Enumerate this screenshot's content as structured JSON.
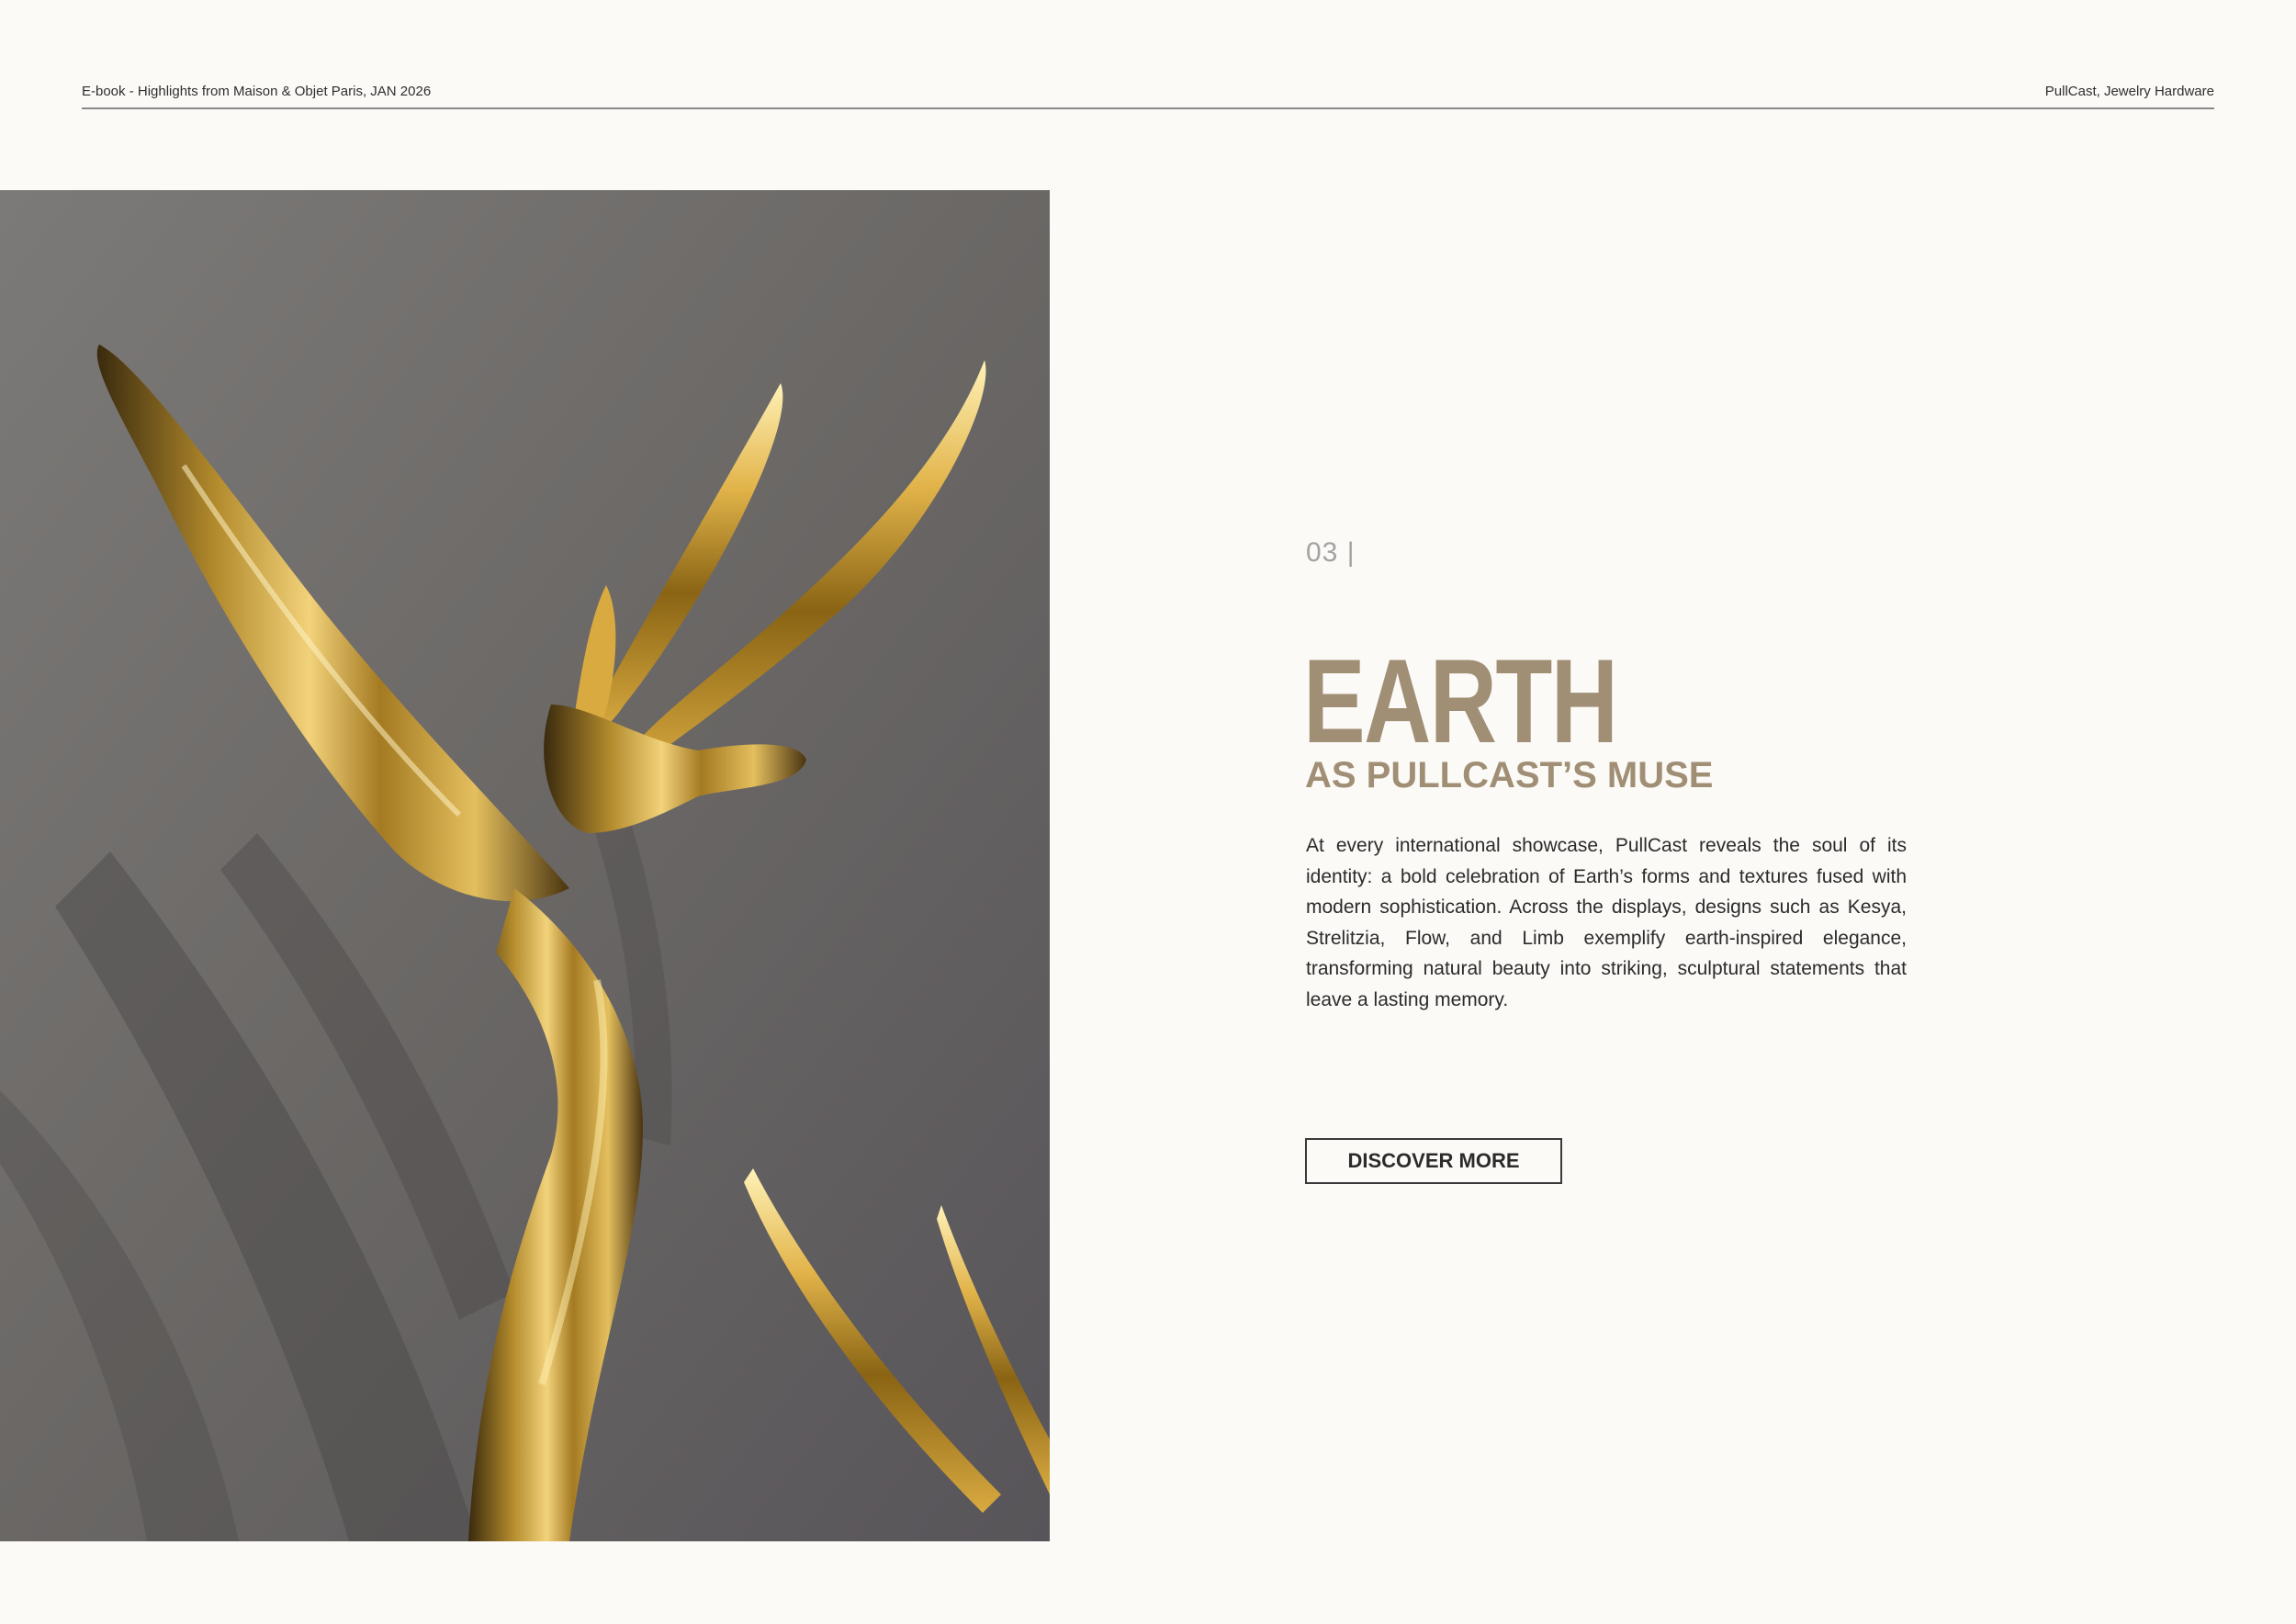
{
  "header": {
    "left_text": "E-book - Highlights from Maison & Objet Paris, JAN 2026",
    "right_text": "PullCast, Jewelry Hardware"
  },
  "section": {
    "number": "03 |",
    "title": "EARTH",
    "subtitle": "AS PULLCAST’S MUSE",
    "body": "At every international showcase, PullCast reveals the soul of its identity: a bold celebration of Earth’s forms and textures fused with modern sophistication. Across the displays, designs such as Kesya, Strelitzia, Flow, and Limb exemplify earth-inspired elegance, transforming natural beauty into striking, sculptural statements that leave a lasting memory.",
    "button_label": "DISCOVER MORE"
  },
  "colors": {
    "page_background": "#fcfaf7",
    "accent": "#a08f75",
    "text": "#2b2b2b",
    "rule": "#8a8a8a"
  },
  "image": {
    "subject": "golden-bird-of-paradise-sculpture"
  }
}
